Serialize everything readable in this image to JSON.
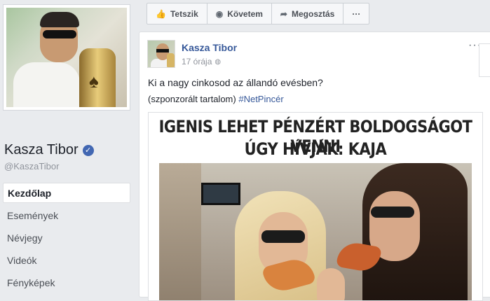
{
  "profile": {
    "name": "Kasza Tibor",
    "handle": "@KaszaTibor",
    "verified_icon": "verified-badge-icon"
  },
  "left_nav": {
    "items": [
      {
        "label": "Kezdőlap",
        "active": true
      },
      {
        "label": "Események",
        "active": false
      },
      {
        "label": "Névjegy",
        "active": false
      },
      {
        "label": "Videók",
        "active": false
      },
      {
        "label": "Fényképek",
        "active": false
      }
    ]
  },
  "actionbar": {
    "like_label": "Tetszik",
    "follow_label": "Követem",
    "share_label": "Megosztás",
    "more_label": "···"
  },
  "post": {
    "author": "Kasza Tibor",
    "time": "17 órája",
    "text": "Ki a nagy cinkosod az állandó evésben?",
    "sponsored": "(szponzorált tartalom)",
    "hashtag": "#NetPincér",
    "more_label": "···",
    "image_title_line1": "IGENIS LEHET PÉNZÉRT BOLDOGSÁGOT VENNI",
    "image_title_line2": "ÚGY HÍVJÁK: KAJA"
  },
  "colors": {
    "background": "#e9ebee",
    "link_blue": "#365899",
    "verified_blue": "#4267b2"
  }
}
